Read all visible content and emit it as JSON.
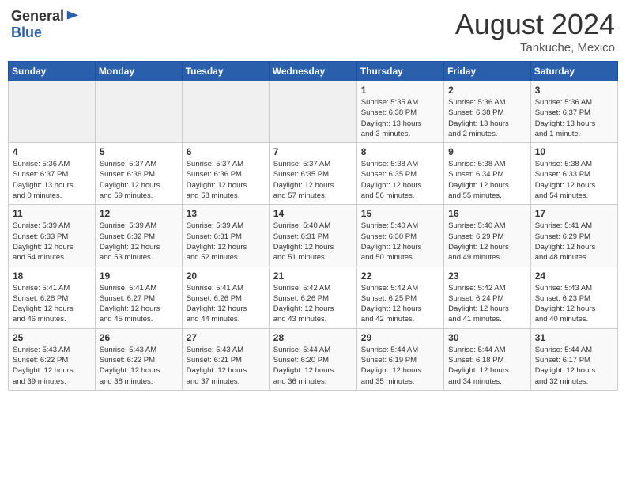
{
  "header": {
    "logo_general": "General",
    "logo_blue": "Blue",
    "title": "August 2024",
    "location": "Tankuche, Mexico"
  },
  "days_of_week": [
    "Sunday",
    "Monday",
    "Tuesday",
    "Wednesday",
    "Thursday",
    "Friday",
    "Saturday"
  ],
  "weeks": [
    [
      {
        "day": null,
        "info": null
      },
      {
        "day": null,
        "info": null
      },
      {
        "day": null,
        "info": null
      },
      {
        "day": null,
        "info": null
      },
      {
        "day": "1",
        "info": "Sunrise: 5:35 AM\nSunset: 6:38 PM\nDaylight: 13 hours\nand 3 minutes."
      },
      {
        "day": "2",
        "info": "Sunrise: 5:36 AM\nSunset: 6:38 PM\nDaylight: 13 hours\nand 2 minutes."
      },
      {
        "day": "3",
        "info": "Sunrise: 5:36 AM\nSunset: 6:37 PM\nDaylight: 13 hours\nand 1 minute."
      }
    ],
    [
      {
        "day": "4",
        "info": "Sunrise: 5:36 AM\nSunset: 6:37 PM\nDaylight: 13 hours\nand 0 minutes."
      },
      {
        "day": "5",
        "info": "Sunrise: 5:37 AM\nSunset: 6:36 PM\nDaylight: 12 hours\nand 59 minutes."
      },
      {
        "day": "6",
        "info": "Sunrise: 5:37 AM\nSunset: 6:36 PM\nDaylight: 12 hours\nand 58 minutes."
      },
      {
        "day": "7",
        "info": "Sunrise: 5:37 AM\nSunset: 6:35 PM\nDaylight: 12 hours\nand 57 minutes."
      },
      {
        "day": "8",
        "info": "Sunrise: 5:38 AM\nSunset: 6:35 PM\nDaylight: 12 hours\nand 56 minutes."
      },
      {
        "day": "9",
        "info": "Sunrise: 5:38 AM\nSunset: 6:34 PM\nDaylight: 12 hours\nand 55 minutes."
      },
      {
        "day": "10",
        "info": "Sunrise: 5:38 AM\nSunset: 6:33 PM\nDaylight: 12 hours\nand 54 minutes."
      }
    ],
    [
      {
        "day": "11",
        "info": "Sunrise: 5:39 AM\nSunset: 6:33 PM\nDaylight: 12 hours\nand 54 minutes."
      },
      {
        "day": "12",
        "info": "Sunrise: 5:39 AM\nSunset: 6:32 PM\nDaylight: 12 hours\nand 53 minutes."
      },
      {
        "day": "13",
        "info": "Sunrise: 5:39 AM\nSunset: 6:31 PM\nDaylight: 12 hours\nand 52 minutes."
      },
      {
        "day": "14",
        "info": "Sunrise: 5:40 AM\nSunset: 6:31 PM\nDaylight: 12 hours\nand 51 minutes."
      },
      {
        "day": "15",
        "info": "Sunrise: 5:40 AM\nSunset: 6:30 PM\nDaylight: 12 hours\nand 50 minutes."
      },
      {
        "day": "16",
        "info": "Sunrise: 5:40 AM\nSunset: 6:29 PM\nDaylight: 12 hours\nand 49 minutes."
      },
      {
        "day": "17",
        "info": "Sunrise: 5:41 AM\nSunset: 6:29 PM\nDaylight: 12 hours\nand 48 minutes."
      }
    ],
    [
      {
        "day": "18",
        "info": "Sunrise: 5:41 AM\nSunset: 6:28 PM\nDaylight: 12 hours\nand 46 minutes."
      },
      {
        "day": "19",
        "info": "Sunrise: 5:41 AM\nSunset: 6:27 PM\nDaylight: 12 hours\nand 45 minutes."
      },
      {
        "day": "20",
        "info": "Sunrise: 5:41 AM\nSunset: 6:26 PM\nDaylight: 12 hours\nand 44 minutes."
      },
      {
        "day": "21",
        "info": "Sunrise: 5:42 AM\nSunset: 6:26 PM\nDaylight: 12 hours\nand 43 minutes."
      },
      {
        "day": "22",
        "info": "Sunrise: 5:42 AM\nSunset: 6:25 PM\nDaylight: 12 hours\nand 42 minutes."
      },
      {
        "day": "23",
        "info": "Sunrise: 5:42 AM\nSunset: 6:24 PM\nDaylight: 12 hours\nand 41 minutes."
      },
      {
        "day": "24",
        "info": "Sunrise: 5:43 AM\nSunset: 6:23 PM\nDaylight: 12 hours\nand 40 minutes."
      }
    ],
    [
      {
        "day": "25",
        "info": "Sunrise: 5:43 AM\nSunset: 6:22 PM\nDaylight: 12 hours\nand 39 minutes."
      },
      {
        "day": "26",
        "info": "Sunrise: 5:43 AM\nSunset: 6:22 PM\nDaylight: 12 hours\nand 38 minutes."
      },
      {
        "day": "27",
        "info": "Sunrise: 5:43 AM\nSunset: 6:21 PM\nDaylight: 12 hours\nand 37 minutes."
      },
      {
        "day": "28",
        "info": "Sunrise: 5:44 AM\nSunset: 6:20 PM\nDaylight: 12 hours\nand 36 minutes."
      },
      {
        "day": "29",
        "info": "Sunrise: 5:44 AM\nSunset: 6:19 PM\nDaylight: 12 hours\nand 35 minutes."
      },
      {
        "day": "30",
        "info": "Sunrise: 5:44 AM\nSunset: 6:18 PM\nDaylight: 12 hours\nand 34 minutes."
      },
      {
        "day": "31",
        "info": "Sunrise: 5:44 AM\nSunset: 6:17 PM\nDaylight: 12 hours\nand 32 minutes."
      }
    ]
  ]
}
